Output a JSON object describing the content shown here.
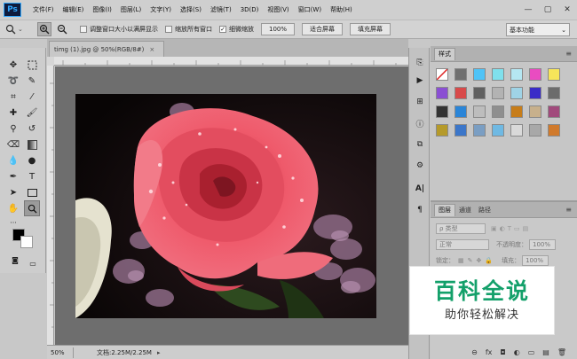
{
  "app": {
    "logo": "Ps"
  },
  "menubar": {
    "items": [
      "文件(F)",
      "编辑(E)",
      "图像(I)",
      "图层(L)",
      "文字(Y)",
      "选择(S)",
      "滤镜(T)",
      "3D(D)",
      "视图(V)",
      "窗口(W)",
      "帮助(H)"
    ],
    "window_controls": [
      "—",
      "▢",
      "✕"
    ]
  },
  "options": {
    "checks": [
      {
        "label": "调整窗口大小以满屏显示",
        "checked": false
      },
      {
        "label": "缩放所有窗口",
        "checked": false
      },
      {
        "label": "细微缩放",
        "checked": true
      }
    ],
    "zoom_value": "100%",
    "buttons": [
      "适合屏幕",
      "填充屏幕"
    ],
    "workspace": "基本功能"
  },
  "document": {
    "tab_title": "timg (1).jpg @ 50%(RGB/8#)",
    "tab_close": "×",
    "status_zoom": "50%",
    "status_doc": "文档:2.25M/2.25M",
    "status_arrow": "▸"
  },
  "panels": {
    "styles": {
      "tab": "样式",
      "menu_icon": "≡",
      "swatch_colors": [
        [
          "#ffffff",
          "#6f6f6f",
          "#4fc3f7",
          "#7fe0ec",
          "#b5e7f2",
          "#e94cc1",
          "#f6e55a"
        ],
        [
          "#8a4fd3",
          "#d84a4a",
          "#606060",
          "#b3b3b3",
          "#9fd3e6",
          "#3a2cc7",
          "#6c6c6c"
        ],
        [
          "#333333",
          "#2a85d8",
          "#bdbdbd",
          "#8f8f8f",
          "#c77d1a",
          "#c7b08c",
          "#a14a7c"
        ],
        [
          "#b59a2a",
          "#3b76c9",
          "#7a9ec3",
          "#6fb9e3",
          "#d9d9d9",
          "#a8a8a8",
          "#d07a2c"
        ]
      ]
    },
    "layers": {
      "tabs": [
        "图层",
        "通道",
        "路径"
      ],
      "filter_kind": "ρ 类型",
      "blend_mode": "正常",
      "opacity_label": "不透明度：",
      "opacity_value": "100%",
      "lock_label": "锁定：",
      "fill_label": "填充：",
      "fill_value": "100%",
      "footer_icons": [
        "⊖",
        "fx",
        "◘",
        "◐",
        "▭",
        "▤",
        "🗑"
      ]
    }
  },
  "watermark": {
    "title": "百科全说",
    "subtitle": "助你轻松解决"
  }
}
